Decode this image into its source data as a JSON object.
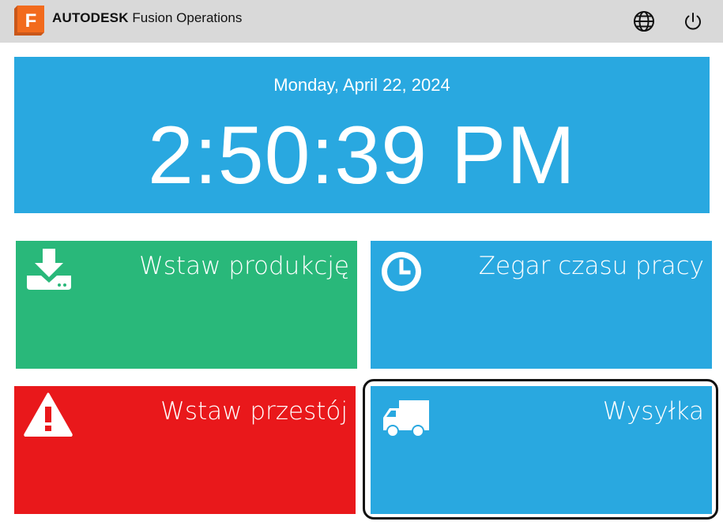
{
  "header": {
    "brand_bold": "AUTODESK",
    "brand_rest": "Fusion Operations",
    "logo_letter": "F",
    "logo_color": "#f26b1d",
    "icons": [
      "globe-icon",
      "power-icon"
    ]
  },
  "clock": {
    "date": "Monday, April 22, 2024",
    "time": "2:50:39 PM",
    "color": "#29a8e0"
  },
  "tiles": [
    {
      "label": "Wstaw produkcję",
      "icon": "download-drive-icon",
      "color": "#29b87a"
    },
    {
      "label": "Zegar czasu pracy",
      "icon": "clock-icon",
      "color": "#29a8e0"
    },
    {
      "label": "Wstaw przestój",
      "icon": "warning-icon",
      "color": "#e9181b"
    },
    {
      "label": "Wysyłka",
      "icon": "truck-icon",
      "color": "#29a8e0",
      "focused": true
    }
  ]
}
